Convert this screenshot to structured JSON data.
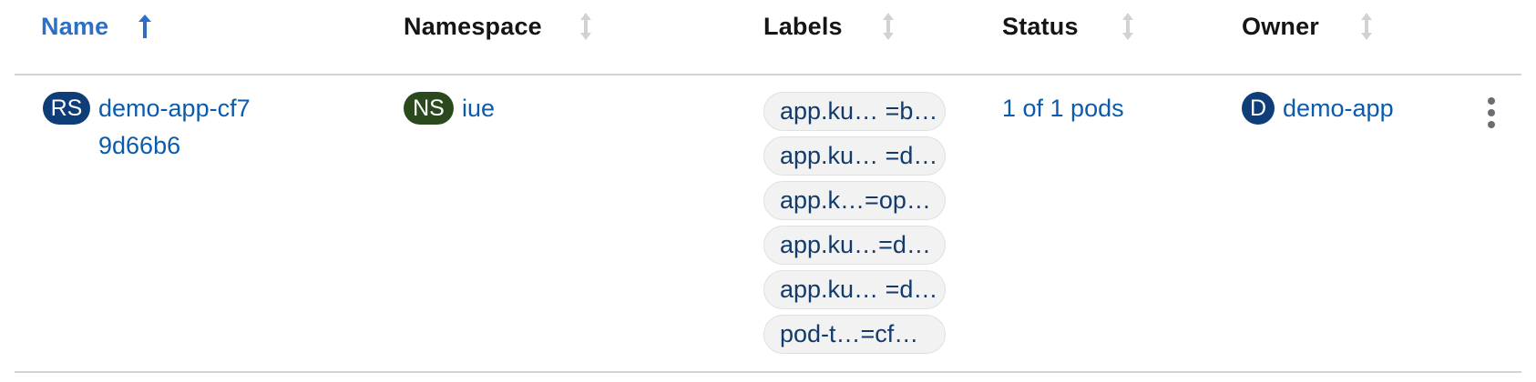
{
  "colors": {
    "link": "#0b5bad",
    "active_header": "#2b6fc7",
    "header_text": "#151515",
    "rs_badge": "#0f3d77",
    "ns_badge": "#2a4a1d",
    "owner_badge": "#0f3d77",
    "chip_bg": "#f2f2f2",
    "chip_text": "#123a6b"
  },
  "table": {
    "columns": [
      {
        "label": "Name",
        "sort": "ascending",
        "icon": "sort-ascending-arrow-icon"
      },
      {
        "label": "Namespace",
        "sort": "none",
        "icon": "sort-icon"
      },
      {
        "label": "Labels",
        "sort": "none",
        "icon": "sort-icon"
      },
      {
        "label": "Status",
        "sort": "none",
        "icon": "sort-icon"
      },
      {
        "label": "Owner",
        "sort": "none",
        "icon": "sort-icon"
      }
    ],
    "rows": [
      {
        "name": {
          "badge": "RS",
          "text": "demo-app-cf79d66b6"
        },
        "namespace": {
          "badge": "NS",
          "text": "iue"
        },
        "labels": [
          "app.ku…  =b…",
          "app.ku… =d…",
          "app.k…=op…",
          "app.ku…=d…",
          "app.ku… =d…",
          "pod-t…=cf…"
        ],
        "status": "1 of 1 pods",
        "owner": {
          "badge": "D",
          "text": "demo-app"
        },
        "actions_icon": "kebab-menu-icon"
      }
    ]
  }
}
